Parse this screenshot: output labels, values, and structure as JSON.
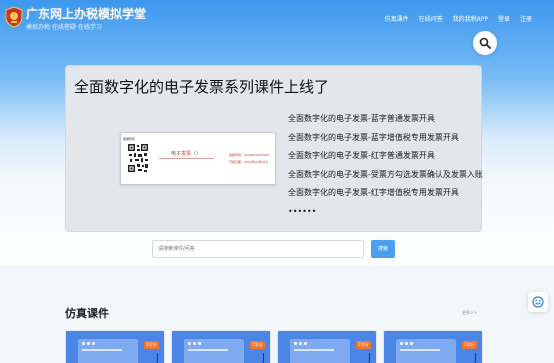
{
  "header": {
    "title": "广东网上办税模拟学堂",
    "subtitle": "模拟办税·在线答疑·在线学习",
    "nav": [
      "仿真课件",
      "在线问答",
      "我的我税APP",
      "登录",
      "注册"
    ]
  },
  "banner": {
    "title": "全面数字化的电子发票系列课件上线了",
    "invoice": {
      "label": "票据预览",
      "name": "电子发票（）",
      "field_no": "发票号码：2244201000000",
      "field_date": "开票日期：2022年02月02日"
    },
    "courses": [
      "全面数字化的电子发票-蓝字普通发票开具",
      "全面数字化的电子发票-蓝字增值税专用发票开具",
      "全面数字化的电子发票-红字普通发票开具",
      "全面数字化的电子发票-受票方勾选发票确认及发票入账",
      "全面数字化的电子发票-红字增值税专用发票开具",
      "••••••"
    ]
  },
  "search": {
    "placeholder": "请搜索课件/问答",
    "button": "搜索"
  },
  "section": {
    "title": "仿真课件",
    "more": "更多>>",
    "cards": [
      {
        "credit": "1学分"
      },
      {
        "credit": "1学分"
      },
      {
        "credit": "1学分"
      },
      {
        "credit": "1学分"
      }
    ]
  },
  "icons": {
    "logo": "tax-emblem-icon",
    "search": "magnifier-icon",
    "side": "customer-service-icon"
  },
  "colors": {
    "brand_blue": "#3e97ee",
    "button_blue": "#4aa0f0",
    "credit_orange": "#f07432",
    "card_blue": "#4b86e6"
  }
}
